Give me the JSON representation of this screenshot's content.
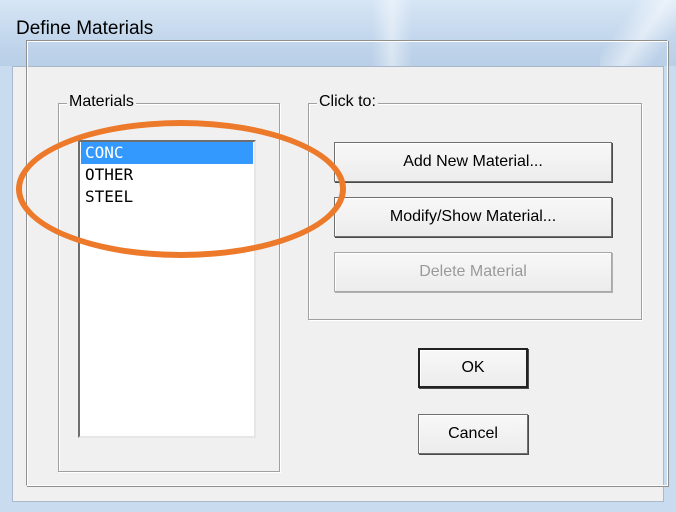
{
  "window": {
    "title": "Define Materials"
  },
  "materials_group": {
    "label": "Materials",
    "items": [
      {
        "label": "CONC",
        "selected": true
      },
      {
        "label": "OTHER",
        "selected": false
      },
      {
        "label": "STEEL",
        "selected": false
      }
    ]
  },
  "actions_group": {
    "label": "Click to:",
    "add_label": "Add New Material...",
    "modify_label": "Modify/Show Material...",
    "delete_label": "Delete Material"
  },
  "dialog_buttons": {
    "ok_label": "OK",
    "cancel_label": "Cancel"
  },
  "annotation": {
    "color": "#ec7a2a",
    "shape": "ellipse"
  },
  "colors": {
    "selection": "#3399ff"
  }
}
